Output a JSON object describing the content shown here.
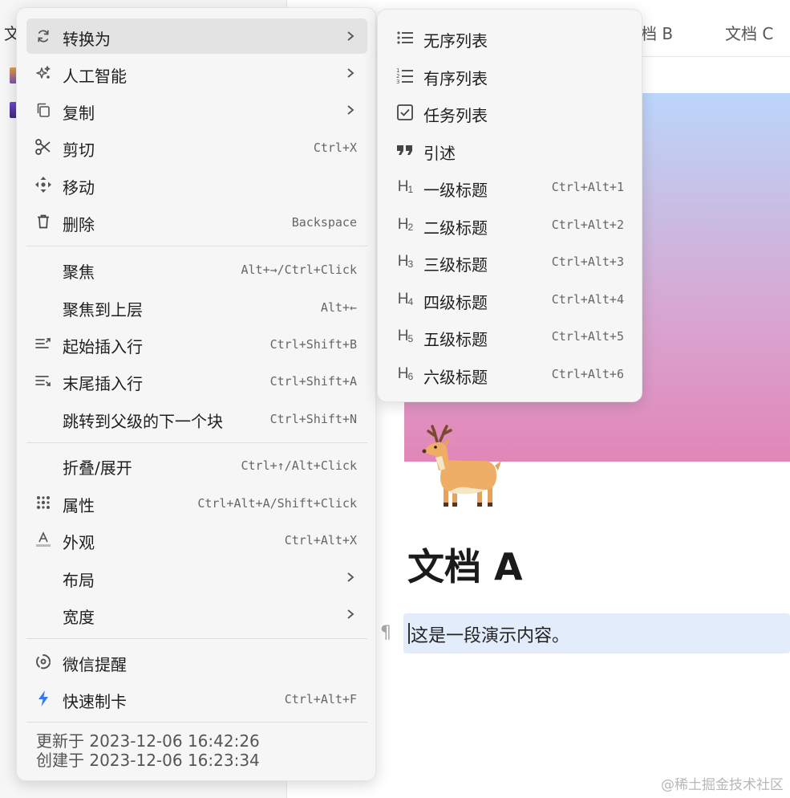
{
  "tabs": {
    "left_fragment": "文",
    "doc_b": "档 B",
    "doc_c": "文档 C"
  },
  "document": {
    "title": "文档 A",
    "paragraph": "这是一段演示内容。",
    "paragraph_mark": "¶"
  },
  "watermark": "@稀土掘金技术社区",
  "context_menu": {
    "group1": [
      {
        "label": "转换为",
        "icon": "refresh-icon",
        "submenu": true,
        "highlighted": true
      },
      {
        "label": "人工智能",
        "icon": "sparkle-icon",
        "submenu": true
      },
      {
        "label": "复制",
        "icon": "copy-icon",
        "submenu": true
      },
      {
        "label": "剪切",
        "icon": "scissors-icon",
        "shortcut": "Ctrl+X"
      },
      {
        "label": "移动",
        "icon": "move-icon"
      },
      {
        "label": "删除",
        "icon": "trash-icon",
        "shortcut": "Backspace"
      }
    ],
    "group2": [
      {
        "label": "聚焦",
        "shortcut": "Alt+→/Ctrl+Click"
      },
      {
        "label": "聚焦到上层",
        "shortcut": "Alt+←"
      },
      {
        "label": "起始插入行",
        "icon": "insert-before-icon",
        "shortcut": "Ctrl+Shift+B"
      },
      {
        "label": "末尾插入行",
        "icon": "insert-after-icon",
        "shortcut": "Ctrl+Shift+A"
      },
      {
        "label": "跳转到父级的下一个块",
        "shortcut": "Ctrl+Shift+N"
      }
    ],
    "group3": [
      {
        "label": "折叠/展开",
        "shortcut": "Ctrl+↑/Alt+Click"
      },
      {
        "label": "属性",
        "icon": "attributes-icon",
        "shortcut": "Ctrl+Alt+A/Shift+Click"
      },
      {
        "label": "外观",
        "icon": "appearance-icon",
        "shortcut": "Ctrl+Alt+X"
      },
      {
        "label": "布局",
        "submenu": true
      },
      {
        "label": "宽度",
        "submenu": true
      }
    ],
    "group4": [
      {
        "label": "微信提醒",
        "icon": "wechat-reminder-icon"
      },
      {
        "label": "快速制卡",
        "icon": "lightning-icon",
        "shortcut": "Ctrl+Alt+F"
      }
    ],
    "updated": "更新于 2023-12-06 16:42:26",
    "created": "创建于 2023-12-06 16:23:34"
  },
  "submenu": {
    "items": [
      {
        "label": "无序列表",
        "icon": "bullet-list-icon"
      },
      {
        "label": "有序列表",
        "icon": "numbered-list-icon"
      },
      {
        "label": "任务列表",
        "icon": "checkbox-icon"
      },
      {
        "label": "引述",
        "icon": "quote-icon"
      },
      {
        "label": "一级标题",
        "icon_text": "H",
        "icon_sub": "1",
        "shortcut": "Ctrl+Alt+1"
      },
      {
        "label": "二级标题",
        "icon_text": "H",
        "icon_sub": "2",
        "shortcut": "Ctrl+Alt+2"
      },
      {
        "label": "三级标题",
        "icon_text": "H",
        "icon_sub": "3",
        "shortcut": "Ctrl+Alt+3"
      },
      {
        "label": "四级标题",
        "icon_text": "H",
        "icon_sub": "4",
        "shortcut": "Ctrl+Alt+4"
      },
      {
        "label": "五级标题",
        "icon_text": "H",
        "icon_sub": "5",
        "shortcut": "Ctrl+Alt+5"
      },
      {
        "label": "六级标题",
        "icon_text": "H",
        "icon_sub": "6",
        "shortcut": "Ctrl+Alt+6"
      }
    ]
  },
  "colors": {
    "menu_bg": "#f6f6f6",
    "highlight": "#e3e3e3",
    "paragraph_highlight": "#e3ecfb",
    "lightning": "#3478f6"
  }
}
